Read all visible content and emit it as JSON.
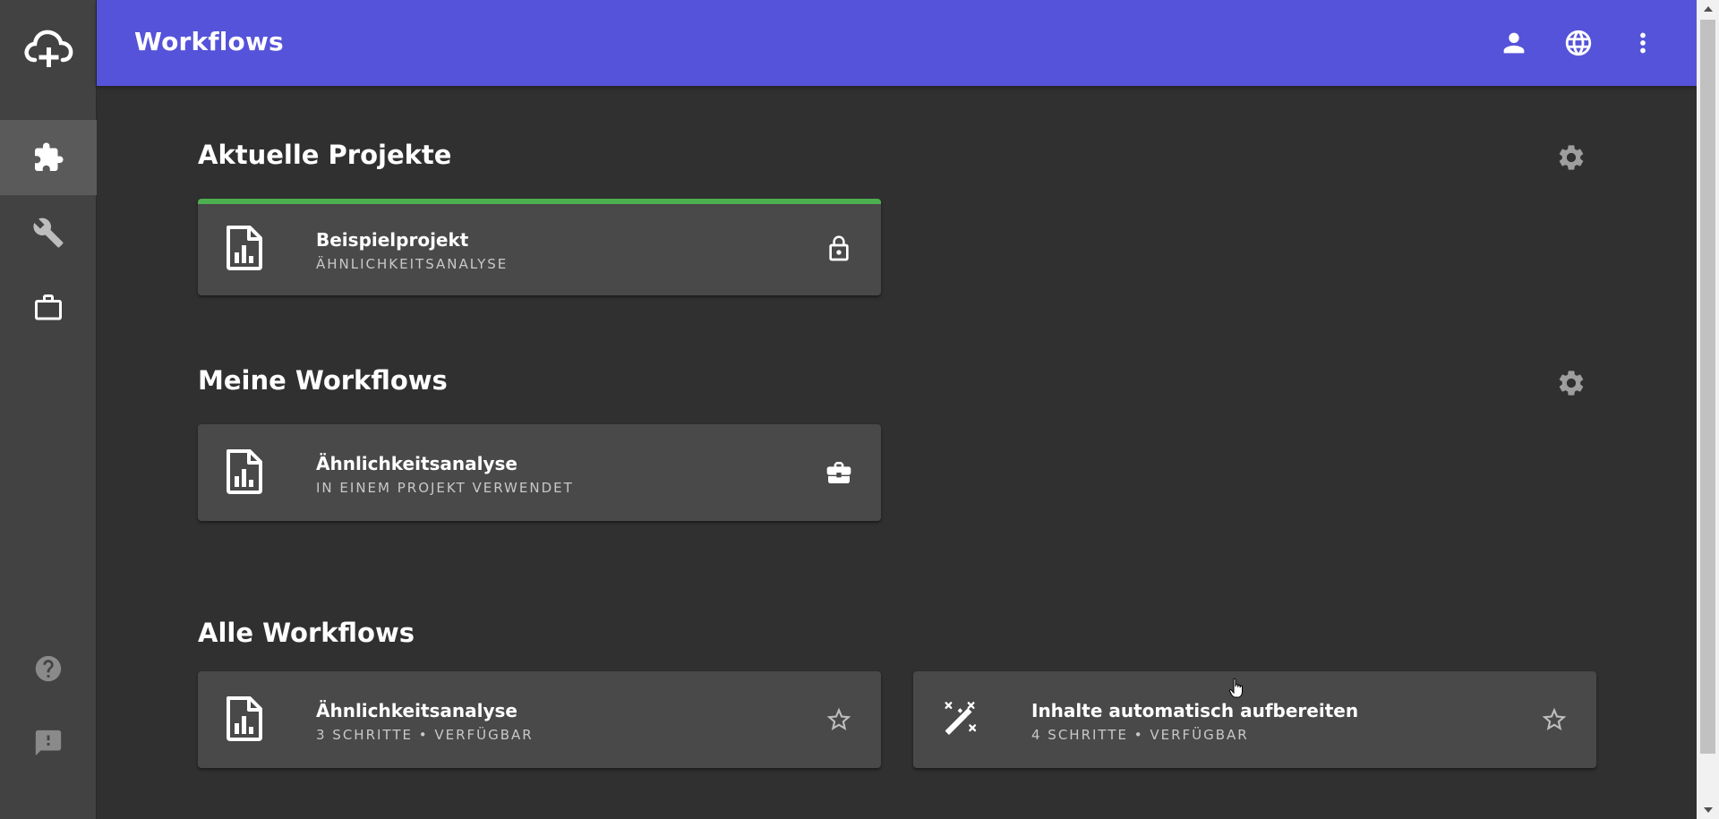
{
  "header": {
    "title": "Workflows",
    "bg_color": "#5553d9",
    "icons": [
      "account-icon",
      "globe-icon",
      "more-vert-icon"
    ]
  },
  "sidebar": {
    "logo_icon": "cloud-plus-icon",
    "items": [
      {
        "icon": "puzzle-icon",
        "active": true
      },
      {
        "icon": "wrench-icon",
        "active": false
      },
      {
        "icon": "briefcase-icon",
        "active": false
      }
    ],
    "bottom_items": [
      {
        "icon": "help-icon"
      },
      {
        "icon": "feedback-icon"
      }
    ]
  },
  "sections": {
    "current_projects": {
      "title": "Aktuelle Projekte",
      "cards": [
        {
          "title": "Beispielprojekt",
          "subtitle": "ÄHNLICHKEITSANALYSE",
          "icon": "chart-file-icon",
          "action_icon": "lock-icon",
          "status_color": "#4caf50"
        }
      ]
    },
    "my_workflows": {
      "title": "Meine Workflows",
      "cards": [
        {
          "title": "Ähnlichkeitsanalyse",
          "subtitle": "IN EINEM PROJEKT VERWENDET",
          "icon": "chart-file-icon",
          "action_icon": "briefcase-icon"
        }
      ]
    },
    "all_workflows": {
      "title": "Alle Workflows",
      "cards": [
        {
          "title": "Ähnlichkeitsanalyse",
          "subtitle": "3 SCHRITTE • VERFÜGBAR",
          "icon": "chart-file-icon",
          "action_icon": "star-outline-icon"
        },
        {
          "title": "Inhalte automatisch aufbereiten",
          "subtitle": "4 SCHRITTE • VERFÜGBAR",
          "icon": "magic-wand-icon",
          "action_icon": "star-outline-icon"
        }
      ]
    }
  }
}
